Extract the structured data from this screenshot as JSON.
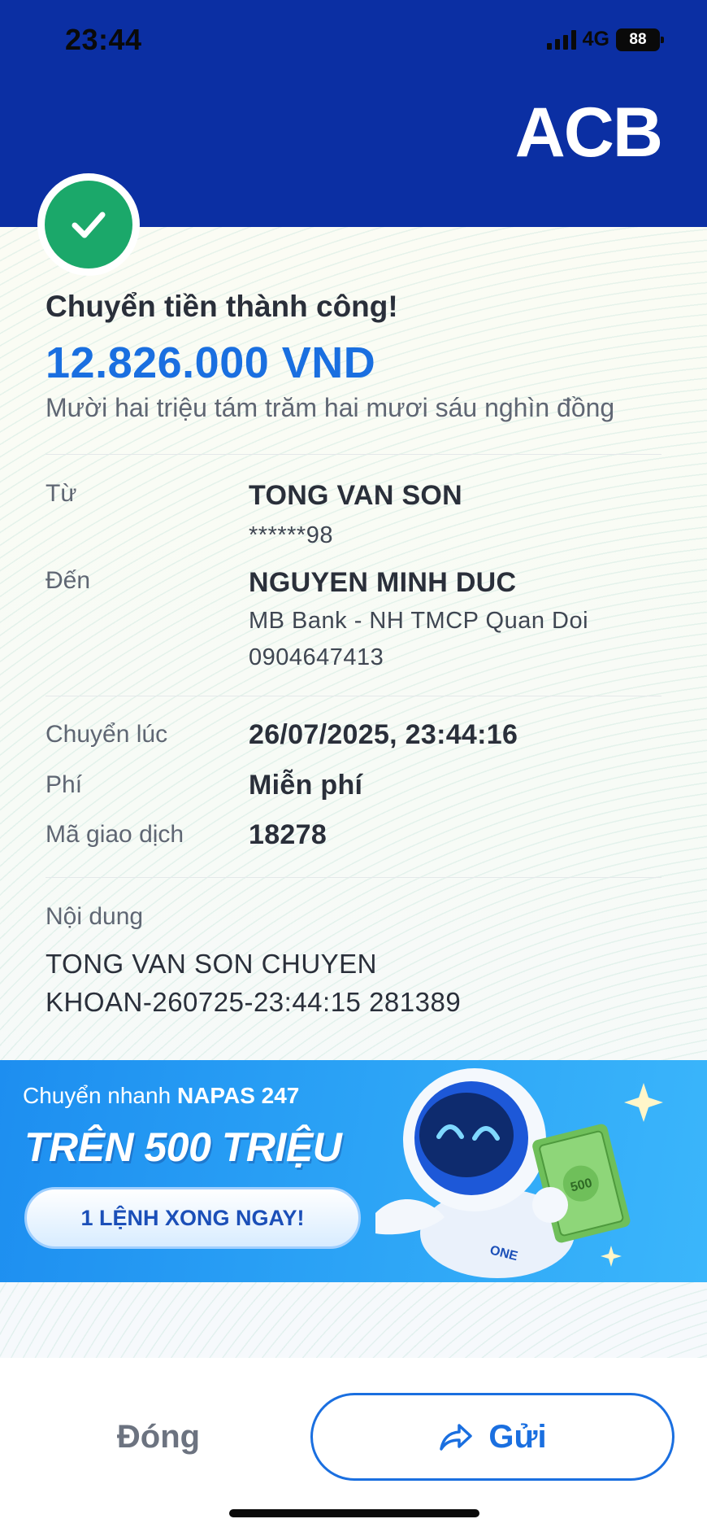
{
  "status_bar": {
    "time": "23:44",
    "network": "4G",
    "battery": "88"
  },
  "brand": {
    "logo_text": "ACB",
    "primary_color": "#0b2fa3",
    "accent_color": "#1a6fe0",
    "success_color": "#1ba86a"
  },
  "result": {
    "title": "Chuyển tiền thành công!",
    "amount": "12.826.000 VND",
    "amount_in_words": "Mười hai triệu tám trăm hai mươi sáu nghìn đồng"
  },
  "details": {
    "from_label": "Từ",
    "from_name": "TONG VAN SON",
    "from_account": "******98",
    "to_label": "Đến",
    "to_name": "NGUYEN MINH DUC",
    "to_bank": "MB Bank - NH TMCP Quan Doi",
    "to_account": "0904647413",
    "time_label": "Chuyển lúc",
    "time_value": "26/07/2025, 23:44:16",
    "fee_label": "Phí",
    "fee_value": "Miễn phí",
    "txn_label": "Mã giao dịch",
    "txn_value": "18278",
    "memo_label": "Nội dung",
    "memo_line1": "TONG VAN SON CHUYEN",
    "memo_line2": "KHOAN-260725-23:44:15 281389"
  },
  "banner": {
    "top_text": "Chuyển nhanh",
    "top_bold": "NAPAS 247",
    "headline": "TRÊN 500 TRIỆU",
    "button_label": "1 LỆNH XONG NGAY!",
    "mascot_badge": "ONE",
    "note_value": "500"
  },
  "actions": {
    "close_label": "Đóng",
    "send_label": "Gửi"
  }
}
